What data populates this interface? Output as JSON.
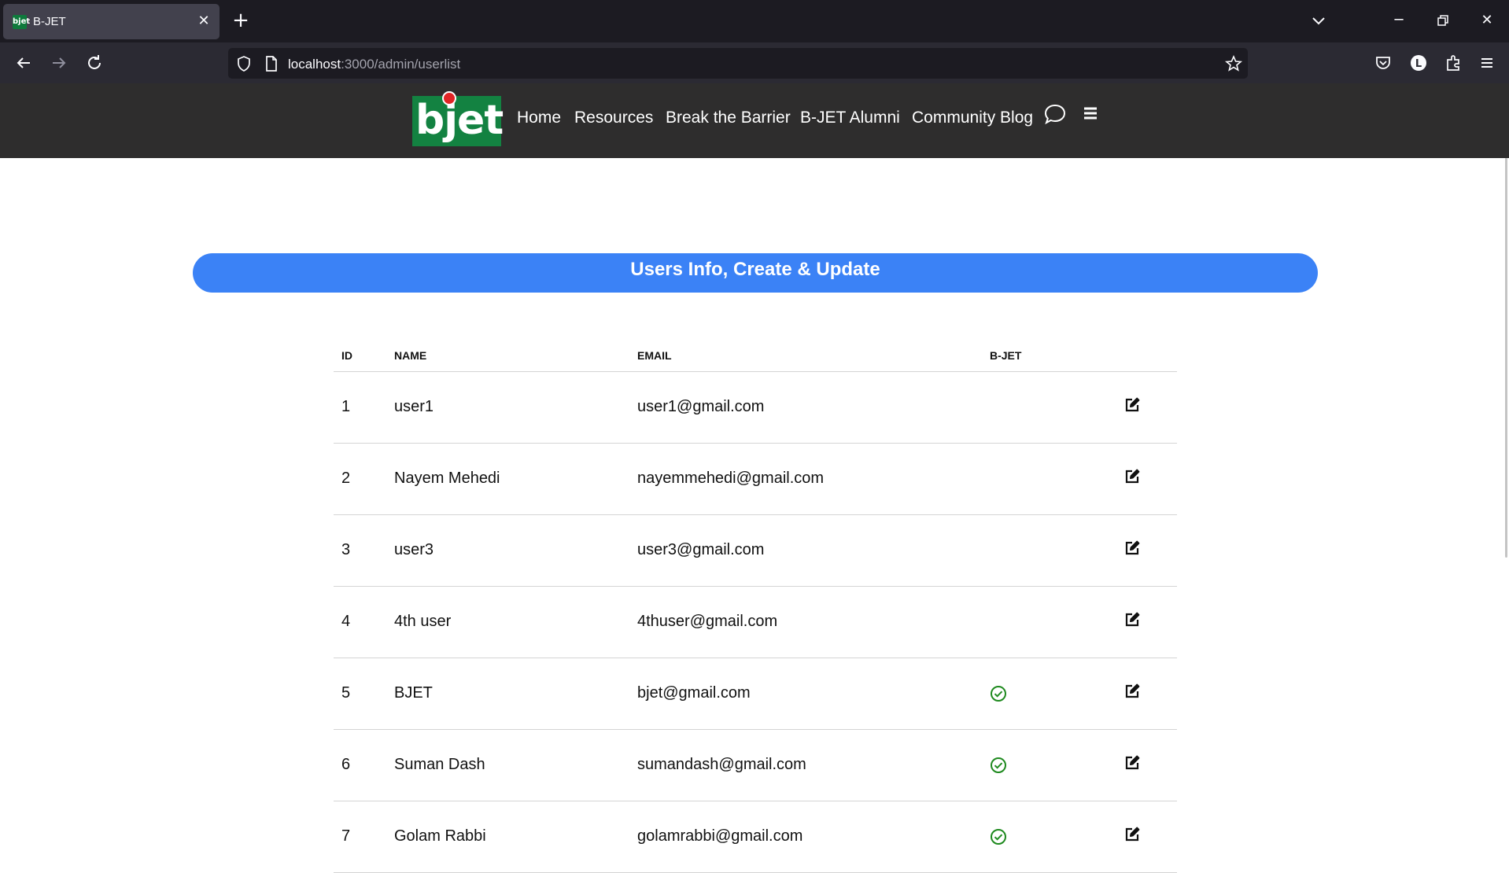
{
  "browser": {
    "tab_title": "B-JET",
    "favicon_text": "bjet",
    "url_host": "localhost",
    "url_path": ":3000/admin/userlist"
  },
  "site": {
    "logo_text": "bjet",
    "nav": [
      "Home",
      "Resources",
      "Break the Barrier",
      "B-JET Alumni",
      "Community Blog"
    ]
  },
  "page": {
    "title": "Users Info, Create & Update"
  },
  "table": {
    "headers": {
      "id": "ID",
      "name": "NAME",
      "email": "EMAIL",
      "bjet": "B-JET"
    },
    "rows": [
      {
        "id": "1",
        "name": "user1",
        "email": "user1@gmail.com",
        "bjet": false
      },
      {
        "id": "2",
        "name": "Nayem Mehedi",
        "email": "nayemmehedi@gmail.com",
        "bjet": false
      },
      {
        "id": "3",
        "name": "user3",
        "email": "user3@gmail.com",
        "bjet": false
      },
      {
        "id": "4",
        "name": "4th user",
        "email": "4thuser@gmail.com",
        "bjet": false
      },
      {
        "id": "5",
        "name": "BJET",
        "email": "bjet@gmail.com",
        "bjet": true
      },
      {
        "id": "6",
        "name": "Suman Dash",
        "email": "sumandash@gmail.com",
        "bjet": true
      },
      {
        "id": "7",
        "name": "Golam Rabbi",
        "email": "golamrabbi@gmail.com",
        "bjet": true
      }
    ]
  },
  "colors": {
    "banner": "#3b82f6",
    "header_bg": "#2e2d2d",
    "logo_green": "#138241",
    "check_green": "#1f8a1f"
  }
}
